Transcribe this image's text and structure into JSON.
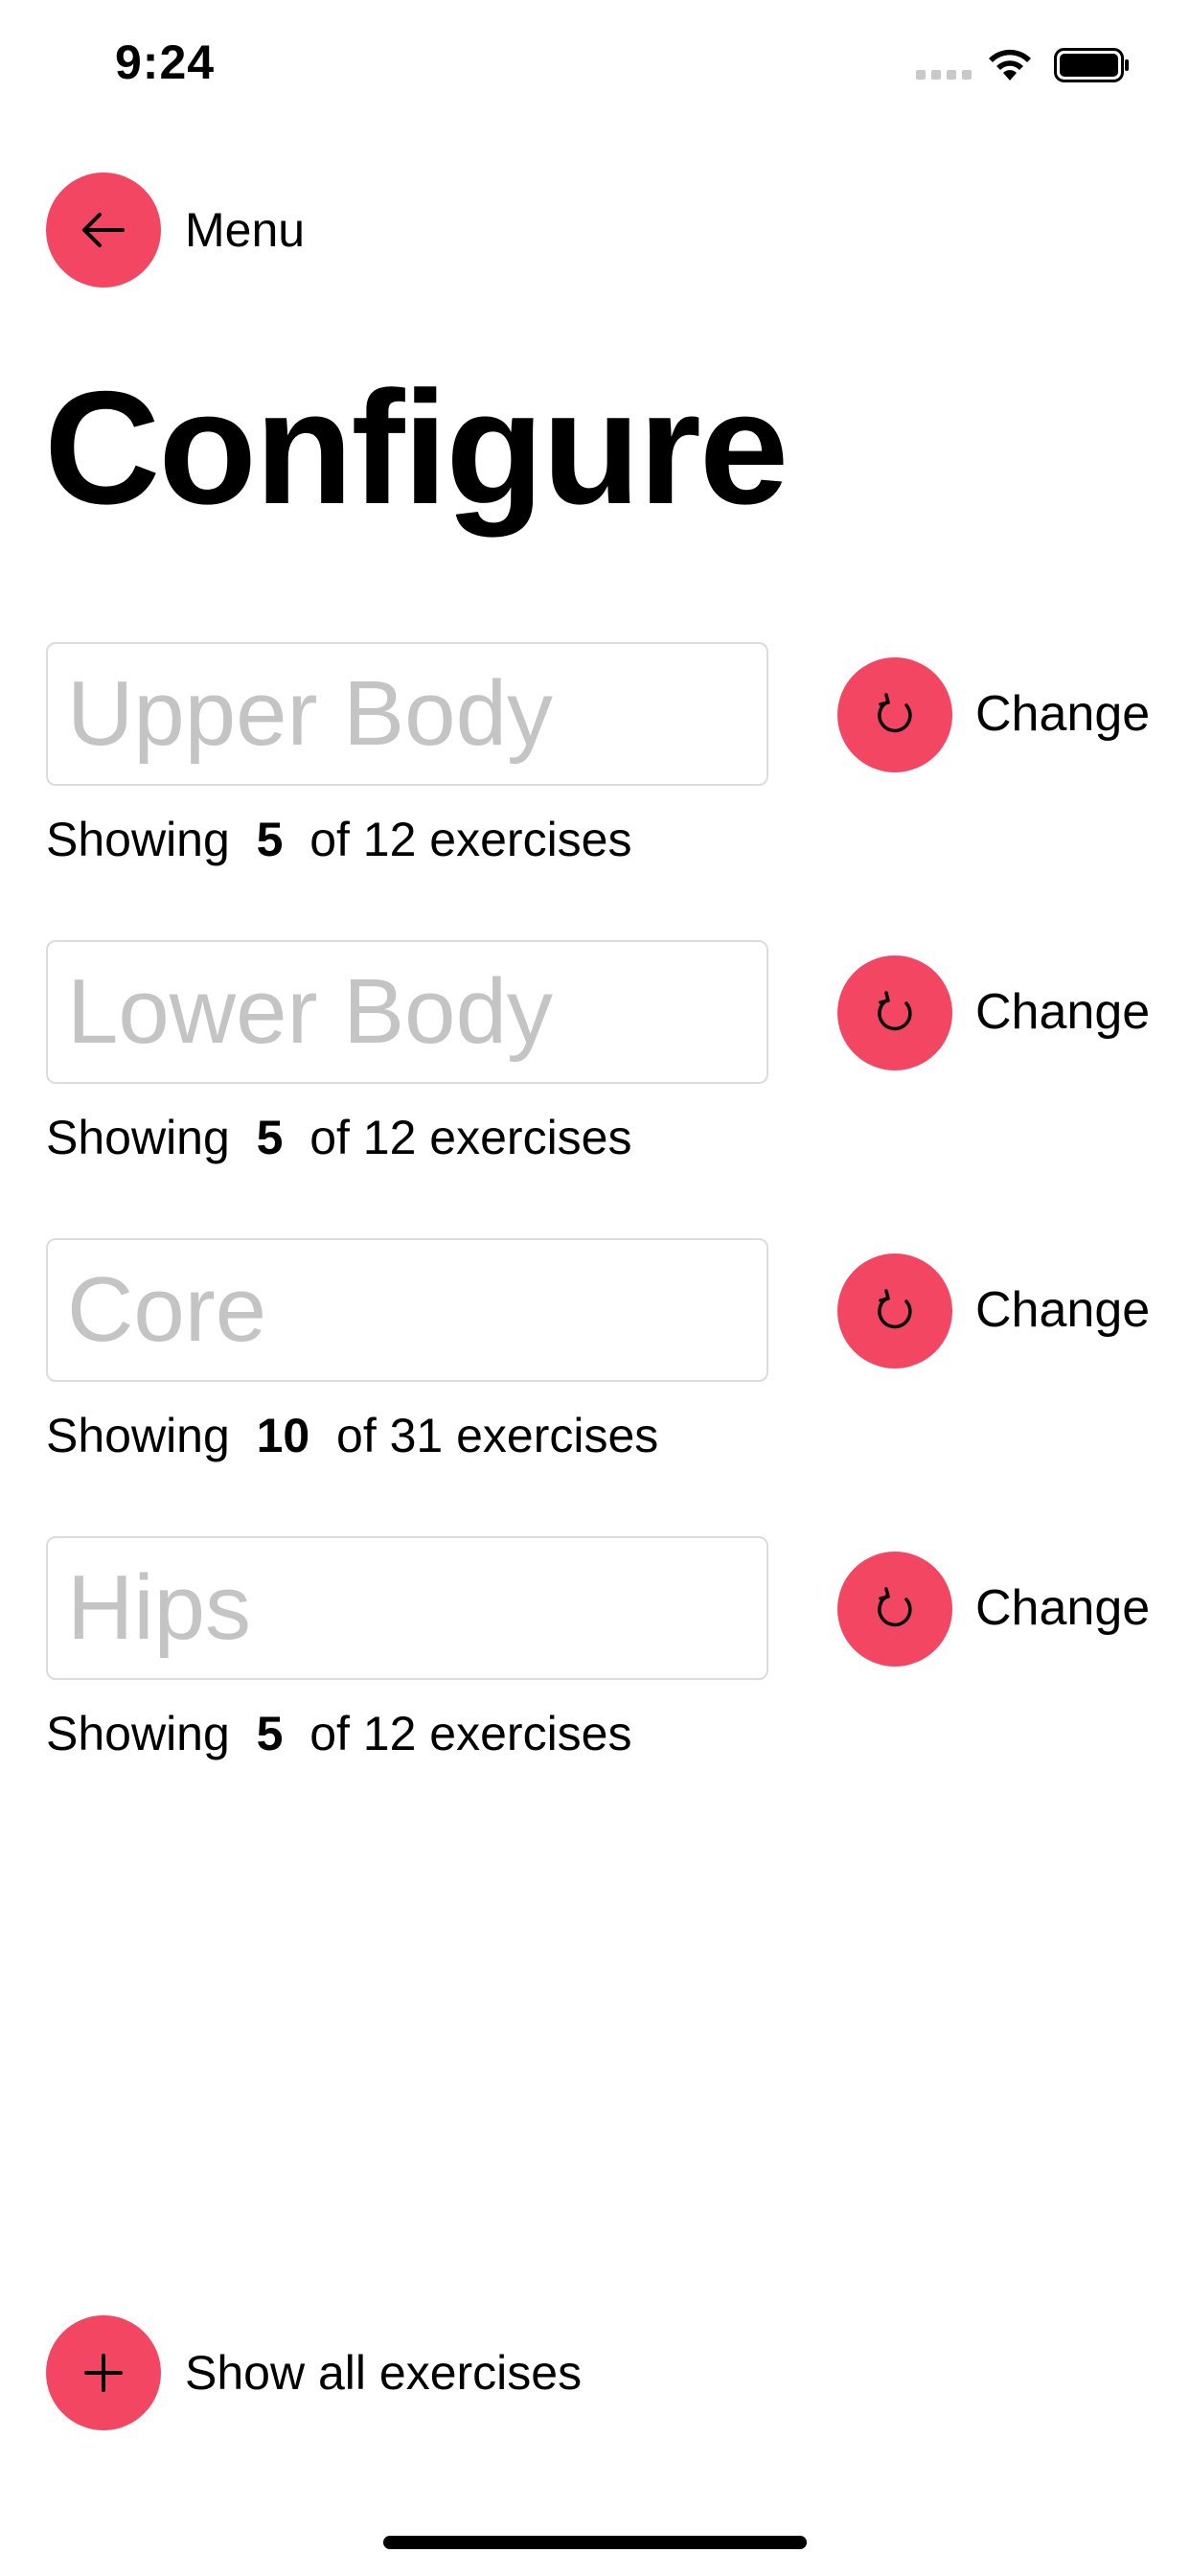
{
  "status_bar": {
    "time": "9:24",
    "icons": [
      "signal-icon",
      "wifi-icon",
      "battery-icon"
    ]
  },
  "header": {
    "back_icon": "arrow-left-icon",
    "back_label": "Menu",
    "title": "Configure"
  },
  "accent_color": "#f34663",
  "categories": [
    {
      "placeholder": "Upper Body",
      "value": "",
      "change_label": "Change",
      "showing_prefix": "Showing",
      "showing_count": "5",
      "showing_suffix": "of 12 exercises"
    },
    {
      "placeholder": "Lower Body",
      "value": "",
      "change_label": "Change",
      "showing_prefix": "Showing",
      "showing_count": "5",
      "showing_suffix": "of 12 exercises"
    },
    {
      "placeholder": "Core",
      "value": "",
      "change_label": "Change",
      "showing_prefix": "Showing",
      "showing_count": "10",
      "showing_suffix": "of 31 exercises"
    },
    {
      "placeholder": "Hips",
      "value": "",
      "change_label": "Change",
      "showing_prefix": "Showing",
      "showing_count": "5",
      "showing_suffix": "of 12 exercises"
    }
  ],
  "footer": {
    "show_all_icon": "plus-icon",
    "show_all_label": "Show all exercises"
  }
}
